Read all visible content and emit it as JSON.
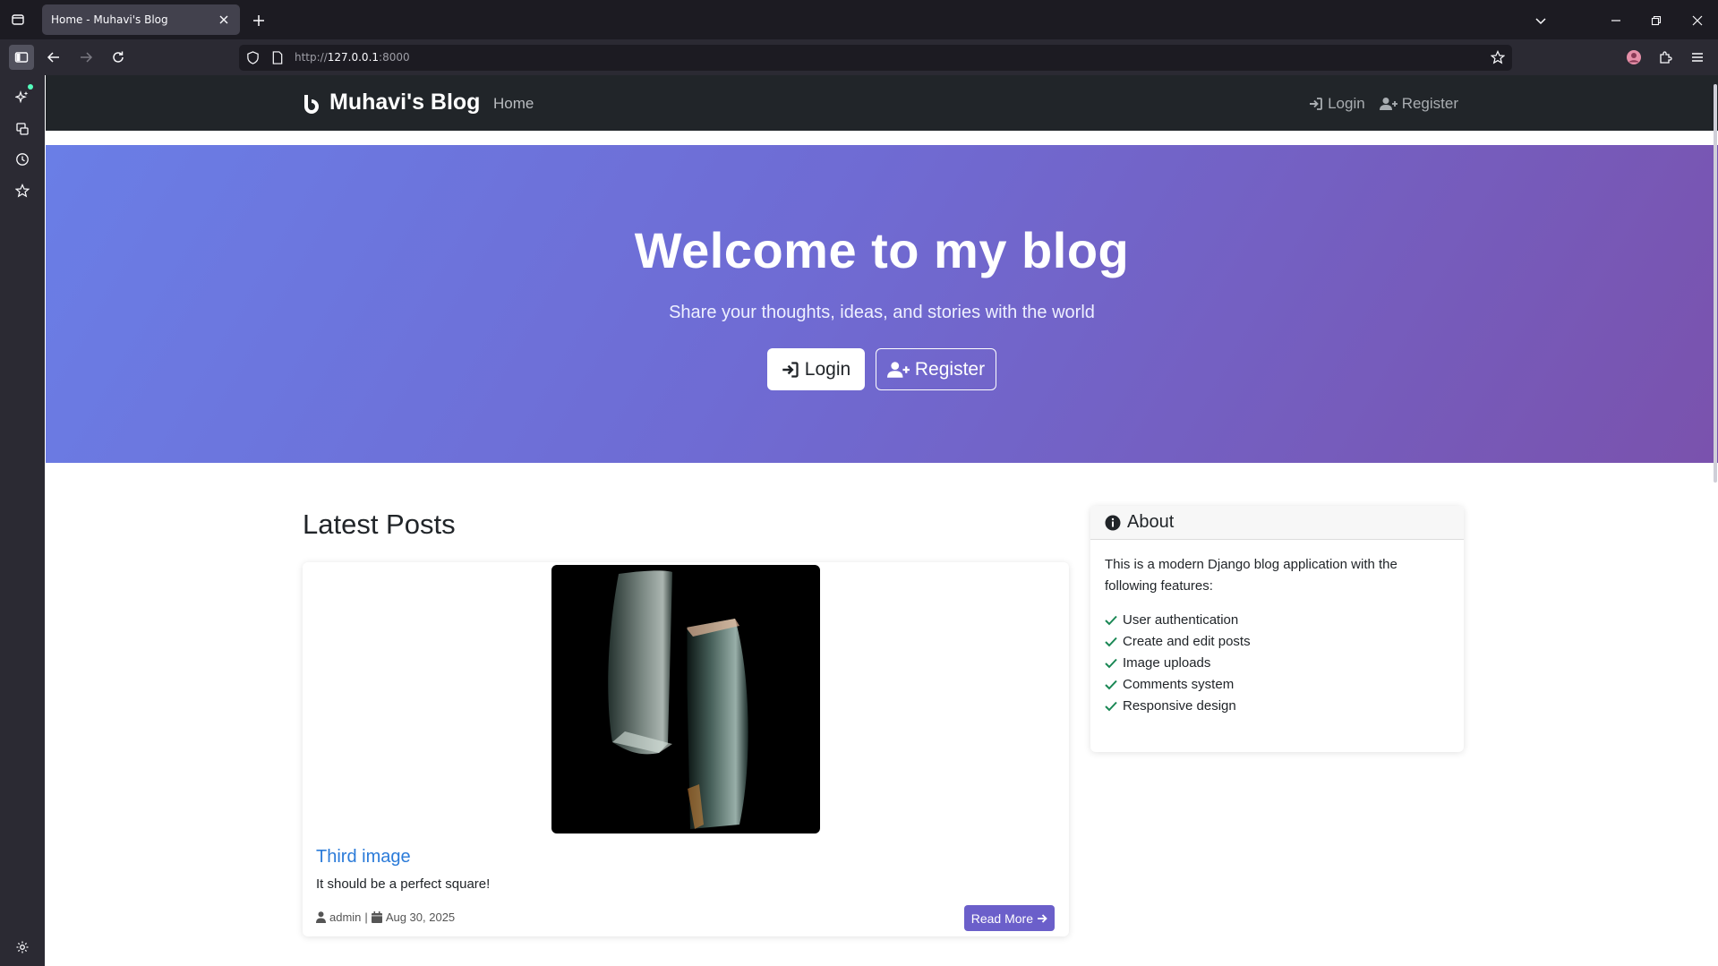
{
  "browser": {
    "tab_title": "Home - Muhavi's Blog",
    "url_prefix": "http://",
    "url_host": "127.0.0.1",
    "url_port": ":8000"
  },
  "site": {
    "brand": "Muhavi's Blog",
    "nav_home": "Home",
    "nav_login": "Login",
    "nav_register": "Register"
  },
  "hero": {
    "title": "Welcome to my blog",
    "subtitle": "Share your thoughts, ideas, and stories with the world",
    "login_label": "Login",
    "register_label": "Register"
  },
  "posts": {
    "section_title": "Latest Posts",
    "items": [
      {
        "title": "Third image",
        "excerpt": "It should be a perfect square!",
        "author": "admin",
        "separator": "|",
        "date": "Aug 30, 2025",
        "read_more": "Read More"
      }
    ]
  },
  "about": {
    "title": "About",
    "intro": "This is a modern Django blog application with the following features:",
    "features": [
      "User authentication",
      "Create and edit posts",
      "Image uploads",
      "Comments system",
      "Responsive design"
    ]
  },
  "colors": {
    "hero_gradient_start": "#6a7ee6",
    "hero_gradient_end": "#7a52ad",
    "navbar": "#212529",
    "link": "#2b7bd9",
    "read_more_button": "#6b5fca",
    "check": "#198754"
  }
}
